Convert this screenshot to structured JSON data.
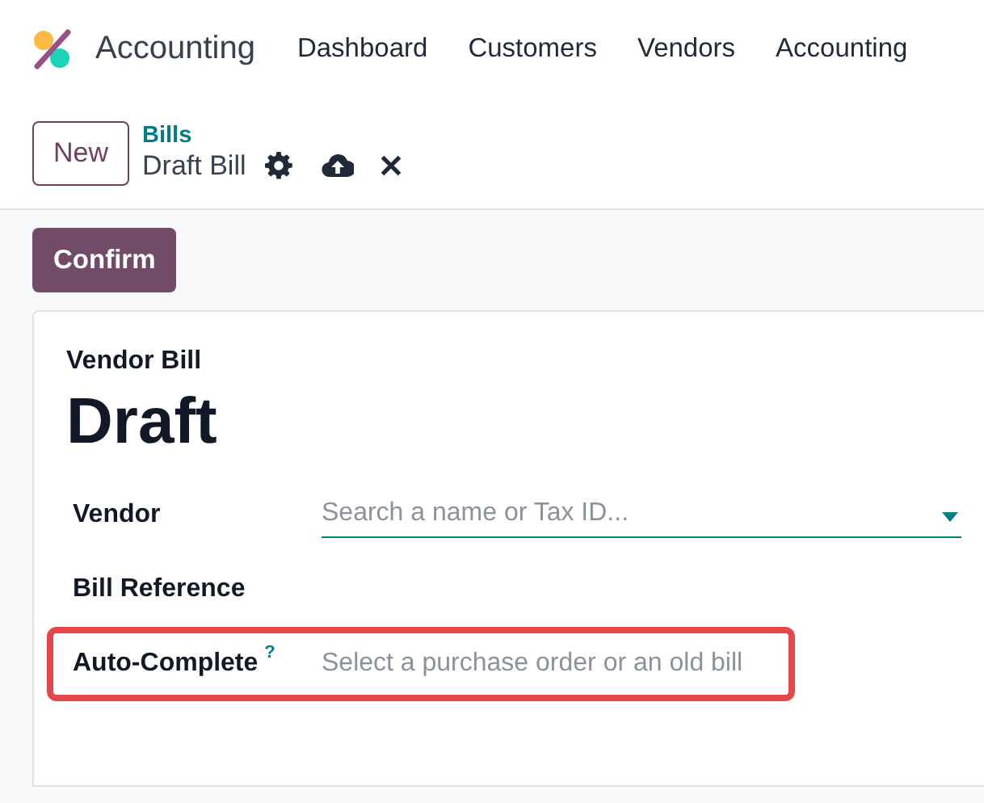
{
  "navbar": {
    "app_name": "Accounting",
    "menu": [
      {
        "label": "Dashboard"
      },
      {
        "label": "Customers"
      },
      {
        "label": "Vendors"
      },
      {
        "label": "Accounting"
      }
    ]
  },
  "control_panel": {
    "new_button": "New",
    "breadcrumb": "Bills",
    "record_title": "Draft Bill"
  },
  "actions": {
    "confirm_button": "Confirm"
  },
  "sheet": {
    "document_type": "Vendor Bill",
    "status": "Draft",
    "fields": [
      {
        "kind": "many2one",
        "label": "Vendor",
        "placeholder": "Search a name or Tax ID...",
        "highlighted": false
      },
      {
        "kind": "label",
        "label": "Bill Reference",
        "highlighted": false
      },
      {
        "kind": "select",
        "label": "Auto-Complete",
        "help_mark": "?",
        "placeholder": "Select a purchase order or an old bill",
        "highlighted": true
      }
    ]
  }
}
